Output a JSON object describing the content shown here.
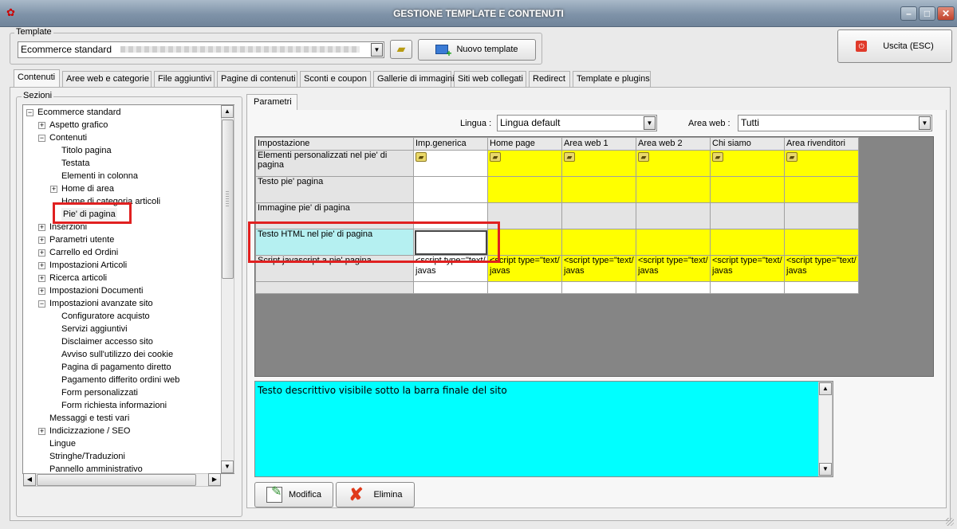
{
  "window": {
    "title": "GESTIONE TEMPLATE E CONTENUTI",
    "min": "–",
    "max": "□",
    "close": "✕"
  },
  "template_group": {
    "label": "Template",
    "selected": "Ecommerce standard",
    "new_button": "Nuovo template"
  },
  "exit_button": "Uscita (ESC)",
  "tabs": [
    {
      "label": "Contenuti",
      "active": true
    },
    {
      "label": "Aree web e categorie"
    },
    {
      "label": "File aggiuntivi"
    },
    {
      "label": "Pagine di contenuti"
    },
    {
      "label": "Sconti e coupon"
    },
    {
      "label": "Gallerie di immagini"
    },
    {
      "label": "Siti web collegati"
    },
    {
      "label": "Redirect"
    },
    {
      "label": "Template e plugins"
    }
  ],
  "sections": {
    "label": "Sezioni",
    "tree": [
      {
        "label": "Ecommerce standard",
        "level": 0,
        "toggle": "−"
      },
      {
        "label": "Aspetto grafico",
        "level": 1,
        "toggle": "+"
      },
      {
        "label": "Contenuti",
        "level": 1,
        "toggle": "−"
      },
      {
        "label": "Titolo pagina",
        "level": 2
      },
      {
        "label": "Testata",
        "level": 2
      },
      {
        "label": "Elementi in colonna",
        "level": 2
      },
      {
        "label": "Home di area",
        "level": 2,
        "toggle": "+"
      },
      {
        "label": "Home di categoria articoli",
        "level": 2
      },
      {
        "label": "Pie' di pagina",
        "level": 2,
        "selected": true
      },
      {
        "label": "Inserzioni",
        "level": 1,
        "toggle": "+"
      },
      {
        "label": "Parametri utente",
        "level": 1,
        "toggle": "+"
      },
      {
        "label": "Carrello ed Ordini",
        "level": 1,
        "toggle": "+"
      },
      {
        "label": "Impostazioni Articoli",
        "level": 1,
        "toggle": "+"
      },
      {
        "label": "Ricerca articoli",
        "level": 1,
        "toggle": "+"
      },
      {
        "label": "Impostazioni Documenti",
        "level": 1,
        "toggle": "+"
      },
      {
        "label": "Impostazioni avanzate sito",
        "level": 1,
        "toggle": "−"
      },
      {
        "label": "Configuratore acquisto",
        "level": 2
      },
      {
        "label": "Servizi aggiuntivi",
        "level": 2
      },
      {
        "label": "Disclaimer accesso sito",
        "level": 2
      },
      {
        "label": "Avviso sull'utilizzo dei cookie",
        "level": 2
      },
      {
        "label": "Pagina di pagamento diretto",
        "level": 2
      },
      {
        "label": "Pagamento differito ordini web",
        "level": 2
      },
      {
        "label": "Form personalizzati",
        "level": 2
      },
      {
        "label": "Form richiesta informazioni",
        "level": 2
      },
      {
        "label": "Messaggi e testi vari",
        "level": 1
      },
      {
        "label": "Indicizzazione / SEO",
        "level": 1,
        "toggle": "+"
      },
      {
        "label": "Lingue",
        "level": 1
      },
      {
        "label": "Stringhe/Traduzioni",
        "level": 1
      },
      {
        "label": "Pannello amministrativo",
        "level": 1
      }
    ]
  },
  "parametri_tab": "Parametri",
  "filters": {
    "lingua_label": "Lingua :",
    "lingua_value": "Lingua default",
    "area_label": "Area web :",
    "area_value": "Tutti"
  },
  "grid": {
    "columns": [
      "Impostazione",
      "Imp.generica",
      "Home page",
      "Area web 1",
      "Area web 2",
      "Chi siamo",
      "Area rivenditori"
    ],
    "rows": [
      {
        "label": "Elementi personalizzati nel pie' di pagina",
        "cells": [
          "folder",
          "folder",
          "folder",
          "folder",
          "folder",
          "folder"
        ]
      },
      {
        "label": "Testo pie' pagina",
        "cells": [
          "",
          "",
          "",
          "",
          "",
          ""
        ]
      },
      {
        "label": "Immagine pie' di pagina",
        "cells": [
          "",
          "",
          "",
          "",
          "",
          ""
        ]
      },
      {
        "label": "Testo HTML nel pie' di pagina",
        "cells": [
          "",
          "",
          "",
          "",
          "",
          ""
        ]
      },
      {
        "label": "Script javascript a pie' pagina",
        "cells": [
          "<script type=\"text/javas",
          "<script type=\"text/javas",
          "<script type=\"text/javas",
          "<script type=\"text/javas",
          "<script type=\"text/javas",
          "<script type=\"text/javas"
        ]
      }
    ]
  },
  "description": "Testo descrittivo visibile sotto la barra finale del sito",
  "buttons": {
    "modifica": "Modifica",
    "elimina": "Elimina"
  },
  "colors": {
    "yellow": "#ffff00",
    "cyan_text": "#00ffff",
    "cyan_row": "#b5f0f1",
    "highlight_red": "#e02020"
  }
}
